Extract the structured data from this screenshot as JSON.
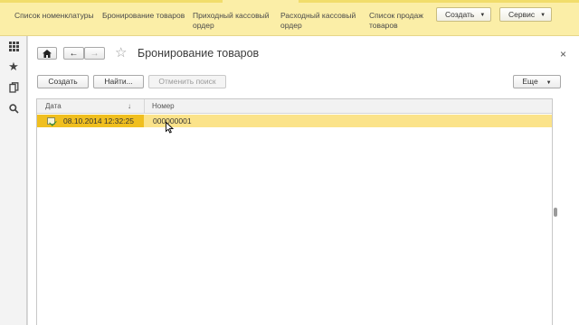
{
  "top_menu": {
    "links": [
      {
        "line1": "Список номенклатуры",
        "line2": ""
      },
      {
        "line1": "Бронирование товаров",
        "line2": ""
      },
      {
        "line1": "Приходный кассовый",
        "line2": "ордер"
      },
      {
        "line1": "Расходный кассовый",
        "line2": "ордер"
      },
      {
        "line1": "Список продаж",
        "line2": "товаров"
      }
    ],
    "create_label": "Создать",
    "service_label": "Сервис"
  },
  "sidebar": {
    "icons": [
      "apps-grid-icon",
      "favorites-star-icon",
      "history-icon",
      "search-icon"
    ]
  },
  "form": {
    "title": "Бронирование товаров",
    "close_label": "×",
    "buttons": {
      "create": "Создать",
      "find": "Найти...",
      "cancel_search": "Отменить поиск",
      "more": "Еще"
    }
  },
  "table": {
    "columns": [
      "Дата",
      "Номер"
    ],
    "sort_indicator": "↓",
    "rows": [
      {
        "date": "08.10.2014 12:32:25",
        "number": "000000001"
      }
    ]
  },
  "colors": {
    "topbar": "#fbeea7",
    "selected_row": "#fbe38a",
    "selected_cell": "#f0bf1f"
  }
}
